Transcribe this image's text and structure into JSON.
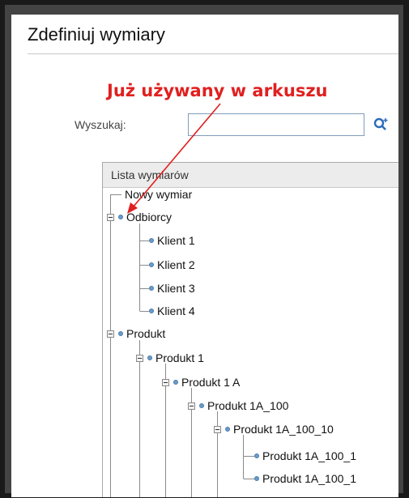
{
  "title": "Zdefiniuj wymiary",
  "annotation": "Już używany w arkuszu",
  "search": {
    "label": "Wyszukaj:",
    "value": "",
    "placeholder": ""
  },
  "list": {
    "header": "Lista wymiarów"
  },
  "tree": {
    "new_dimension": "Nowy wymiar",
    "odbiorcy": "Odbiorcy",
    "klient_1": "Klient 1",
    "klient_2": "Klient 2",
    "klient_3": "Klient 3",
    "klient_4": "Klient 4",
    "produkt": "Produkt",
    "produkt_1": "Produkt 1",
    "produkt_1a": "Produkt 1 A",
    "produkt_1a_100": "Produkt 1A_100",
    "produkt_1a_100_10": "Produkt 1A_100_10",
    "produkt_1a_100_1": "Produkt 1A_100_1",
    "produkt_1a_100_cut": "Produkt 1A_100_1"
  },
  "colors": {
    "annotation": "#e02020",
    "dot": "#6a9ccb",
    "header_bg": "#ececec"
  }
}
